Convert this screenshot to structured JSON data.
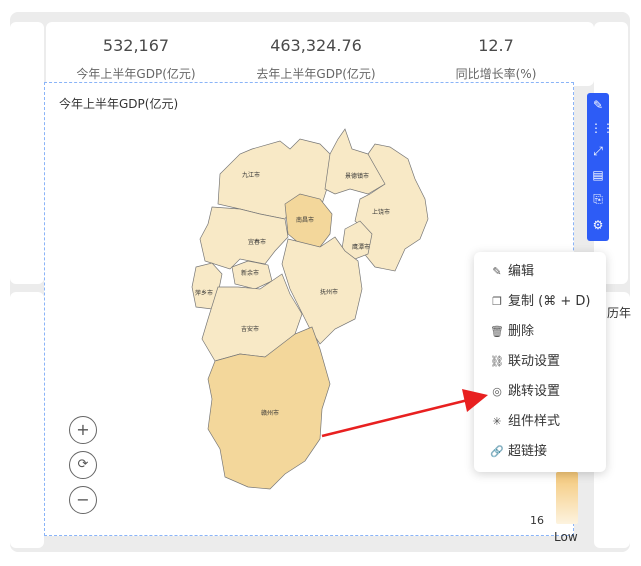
{
  "kpis": [
    {
      "value": "532,167",
      "label": "今年上半年GDP(亿元)"
    },
    {
      "value": "463,324.76",
      "label": "去年上半年GDP(亿元)"
    },
    {
      "value": "12.7",
      "label": "同比增长率(%)"
    }
  ],
  "map": {
    "title": "今年上半年GDP(亿元)",
    "regions": [
      "九江市",
      "景德镇市",
      "上饶市",
      "南昌市",
      "鹰潭市",
      "宜春市",
      "新余市",
      "萍乡市",
      "抚州市",
      "吉安市",
      "赣州市"
    ],
    "legend_value": "16",
    "legend_low": "Low",
    "side_text": "历年"
  },
  "zoom": {
    "in": "+",
    "reset": "⟳",
    "out": "−"
  },
  "menu": {
    "items": [
      {
        "label": "编辑",
        "icon": "edit-icon"
      },
      {
        "label": "复制 (⌘ + D)",
        "icon": "copy-icon"
      },
      {
        "label": "删除",
        "icon": "delete-icon"
      },
      {
        "label": "联动设置",
        "icon": "link-icon"
      },
      {
        "label": "跳转设置",
        "icon": "jump-icon"
      },
      {
        "label": "组件样式",
        "icon": "style-icon"
      },
      {
        "label": "超链接",
        "icon": "hyperlink-icon"
      }
    ]
  },
  "toolbar_icons": [
    "edit-icon",
    "layout-icon",
    "expand-icon",
    "view-data-icon",
    "export-icon",
    "settings-icon"
  ],
  "colors": {
    "accent": "#2d5cf6",
    "arrow": "#e82020",
    "map_fill": "#f8e9c6",
    "map_highlight": "#f3d79b"
  }
}
